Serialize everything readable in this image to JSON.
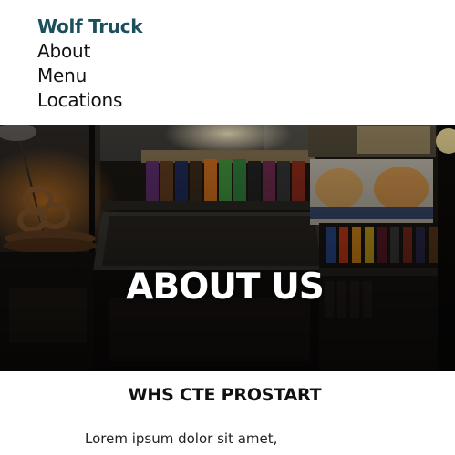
{
  "colors": {
    "brand": "#1b4f5c",
    "nav_text": "#111111",
    "hero_title": "#ffffff"
  },
  "header": {
    "brand": "Wolf Truck",
    "nav": [
      {
        "label": "About"
      },
      {
        "label": "Menu"
      },
      {
        "label": "Locations"
      }
    ]
  },
  "hero": {
    "title": "ABOUT US",
    "image_description_icon": "food-stand-photo"
  },
  "main": {
    "heading": "WHS CTE PROSTART",
    "paragraph": "Lorem ipsum dolor sit amet,"
  }
}
